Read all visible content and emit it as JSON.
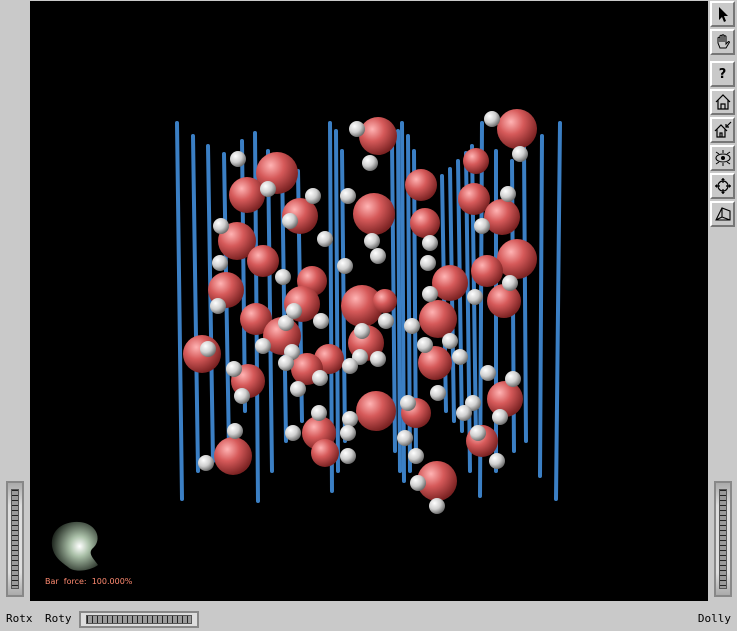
{
  "viewer": {
    "force_label": "Bar  force:",
    "force_value": "100.000%"
  },
  "bottom_bar": {
    "rotx_label": "Rotx",
    "roty_label": "Roty",
    "dolly_label": "Dolly"
  },
  "toolbar": {
    "tools": [
      {
        "name": "select-arrow-icon"
      },
      {
        "name": "hand-view-icon"
      },
      {
        "name": "help-icon",
        "glyph": "?"
      },
      {
        "name": "home-icon"
      },
      {
        "name": "set-home-icon"
      },
      {
        "name": "view-all-icon"
      },
      {
        "name": "seek-icon"
      },
      {
        "name": "projection-icon"
      }
    ]
  },
  "colors": {
    "background": "#000000",
    "rods": "#3b7fc4",
    "oxygen": "#d95a5a",
    "hydrogen": "#e4e4e4",
    "overlay_text": "#ff8a70"
  }
}
